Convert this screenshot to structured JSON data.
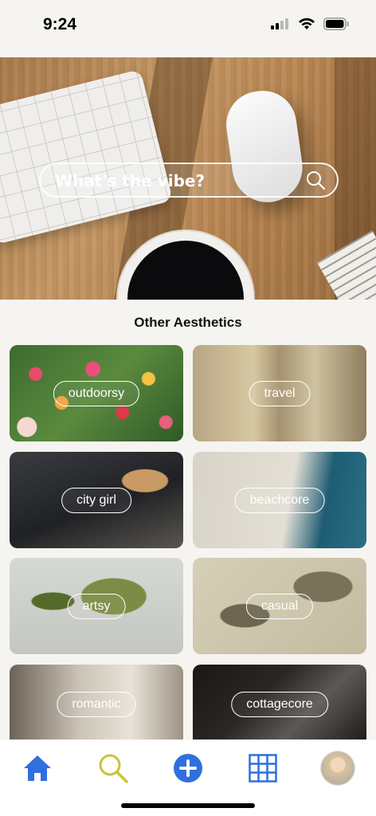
{
  "status_bar": {
    "time": "9:24"
  },
  "hero": {
    "search_placeholder": "What's the vibe?"
  },
  "section": {
    "title": "Other Aesthetics"
  },
  "aesthetics": [
    {
      "label": "outdoorsy"
    },
    {
      "label": "travel"
    },
    {
      "label": "city girl"
    },
    {
      "label": "beachcore"
    },
    {
      "label": "artsy"
    },
    {
      "label": "casual"
    },
    {
      "label": "romantic"
    },
    {
      "label": "cottagecore"
    }
  ],
  "tabbar": {
    "icons": [
      "home-icon",
      "search-icon",
      "add-icon",
      "grid-icon",
      "profile-avatar"
    ],
    "active_color": "#2f6fde",
    "search_color": "#c9c43a"
  }
}
